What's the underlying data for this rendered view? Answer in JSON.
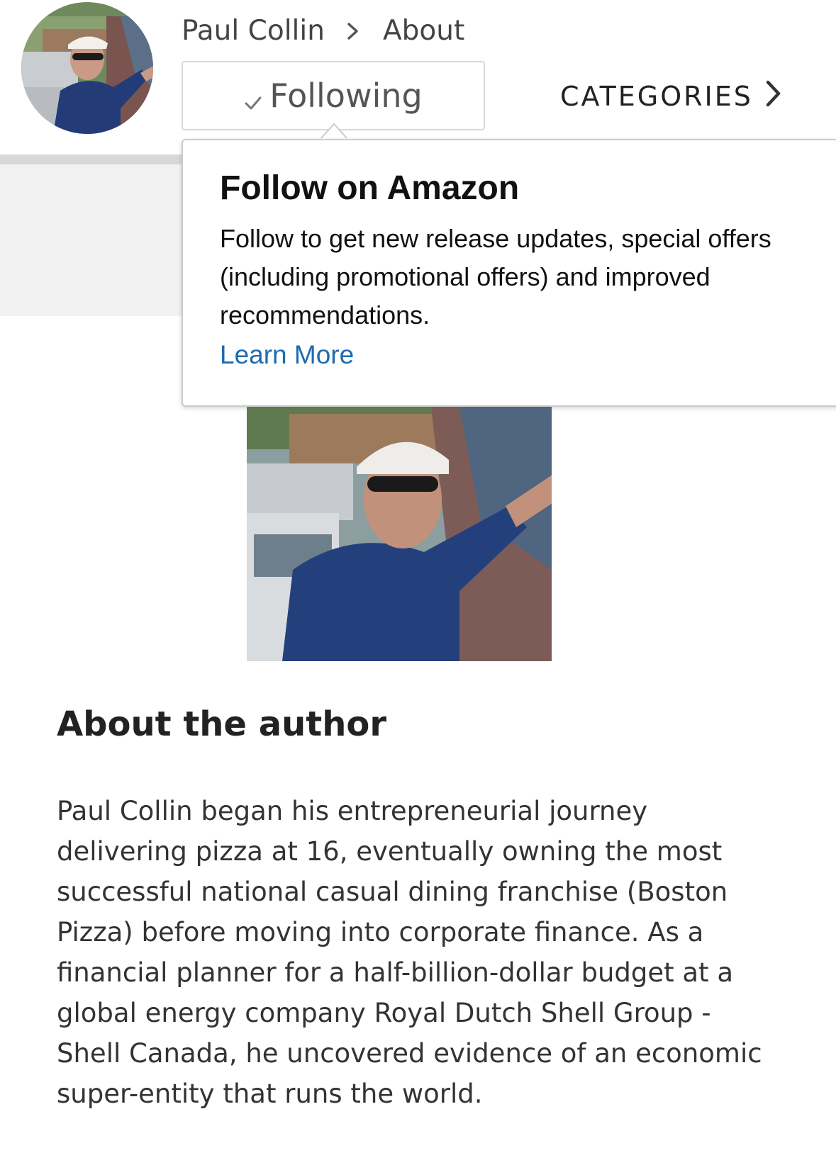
{
  "breadcrumb": {
    "author": "Paul Collin",
    "section": "About"
  },
  "follow_button": {
    "label": "Following",
    "check_icon": "check-icon"
  },
  "categories": {
    "label": "CATEGORIES",
    "icon": "chevron-right-icon"
  },
  "popover": {
    "title": "Follow on Amazon",
    "lines": [
      "Follow to get new release updates, special offers",
      "(including promotional offers) and improved",
      "recommendations."
    ],
    "link": "Learn More"
  },
  "about": {
    "heading": "About the author",
    "lines": [
      "Paul Collin began his entrepreneurial journey",
      "delivering pizza at 16, eventually owning the most",
      "successful national casual dining franchise (Boston",
      "Pizza) before moving into corporate finance. As a",
      "financial planner for a half-billion-dollar budget at a",
      "global energy company Royal Dutch Shell Group -",
      "Shell Canada, he uncovered evidence of an economic",
      "super-entity that runs the world."
    ]
  },
  "colors": {
    "link": "#1e6bb0",
    "border": "#d5d9d9",
    "panel": "#f2f2f2"
  }
}
